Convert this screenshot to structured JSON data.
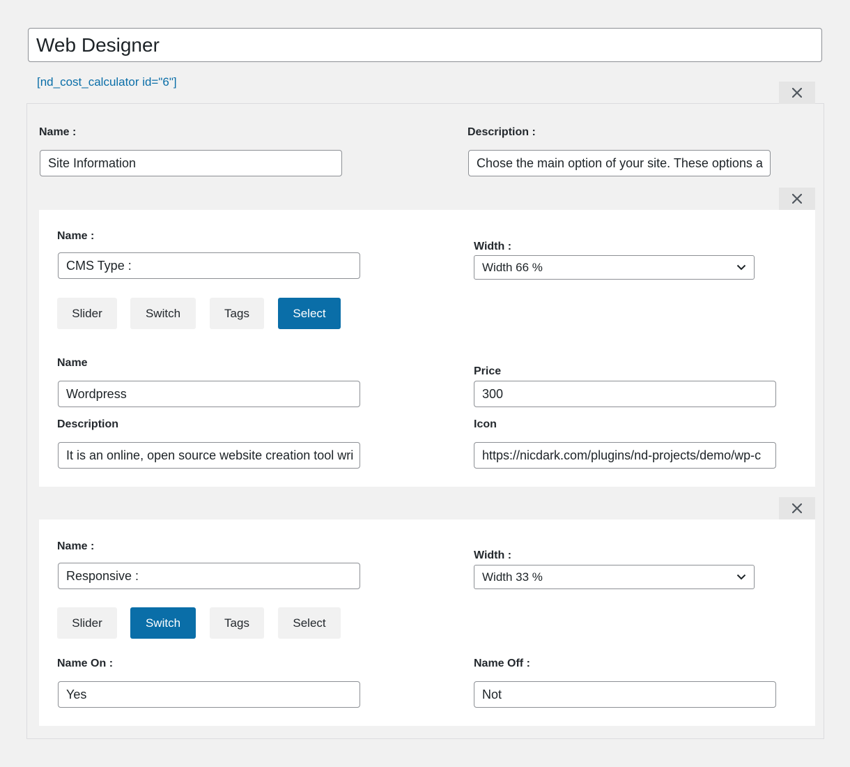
{
  "calculator": {
    "title": "Web Designer",
    "shortcode": "[nd_cost_calculator id=\"6\"]"
  },
  "section": {
    "name_label": "Name :",
    "name_value": "Site Information",
    "description_label": "Description :",
    "description_value": "Chose the main option of your site. These options a"
  },
  "option1": {
    "name_label": "Name :",
    "name_value": "CMS Type :",
    "width_label": "Width :",
    "width_value": "Width 66 %",
    "types": [
      "Slider",
      "Switch",
      "Tags",
      "Select"
    ],
    "active_type": "Select",
    "item_name_label": "Name",
    "item_name_value": "Wordpress",
    "price_label": "Price",
    "price_value": "300",
    "item_description_label": "Description",
    "item_description_value": "It is an online, open source website creation tool wri",
    "icon_label": "Icon",
    "icon_value": "https://nicdark.com/plugins/nd-projects/demo/wp-c"
  },
  "option2": {
    "name_label": "Name :",
    "name_value": "Responsive :",
    "width_label": "Width :",
    "width_value": "Width 33 %",
    "types": [
      "Slider",
      "Switch",
      "Tags",
      "Select"
    ],
    "active_type": "Switch",
    "name_on_label": "Name On :",
    "name_on_value": "Yes",
    "name_off_label": "Name Off :",
    "name_off_value": "Not"
  },
  "icons": {
    "close": "close-icon",
    "dropdown": "chevron-down-icon"
  },
  "colors": {
    "accent": "#0a6ea8",
    "background": "#f1f1f1",
    "panel": "#ffffff"
  }
}
